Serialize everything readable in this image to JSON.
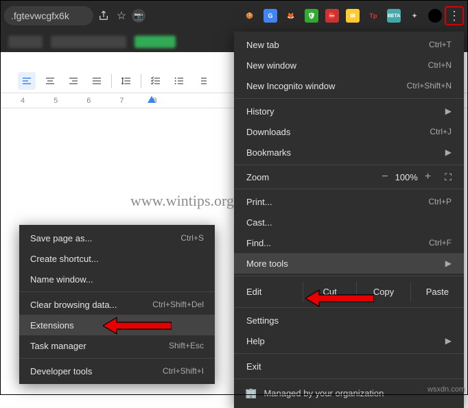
{
  "address_bar": {
    "url_fragment": ".fgtevwcgfx6k"
  },
  "ruler": {
    "marks": [
      "4",
      "5",
      "6",
      "7",
      "8"
    ]
  },
  "main_menu": {
    "new_tab": {
      "label": "New tab",
      "shortcut": "Ctrl+T"
    },
    "new_window": {
      "label": "New window",
      "shortcut": "Ctrl+N"
    },
    "new_incognito": {
      "label": "New Incognito window",
      "shortcut": "Ctrl+Shift+N"
    },
    "history": {
      "label": "History"
    },
    "downloads": {
      "label": "Downloads",
      "shortcut": "Ctrl+J"
    },
    "bookmarks": {
      "label": "Bookmarks"
    },
    "zoom": {
      "label": "Zoom",
      "value": "100%"
    },
    "print": {
      "label": "Print...",
      "shortcut": "Ctrl+P"
    },
    "cast": {
      "label": "Cast..."
    },
    "find": {
      "label": "Find...",
      "shortcut": "Ctrl+F"
    },
    "more_tools": {
      "label": "More tools"
    },
    "edit": {
      "label": "Edit",
      "cut": "Cut",
      "copy": "Copy",
      "paste": "Paste"
    },
    "settings": {
      "label": "Settings"
    },
    "help": {
      "label": "Help"
    },
    "exit": {
      "label": "Exit"
    },
    "managed": {
      "label": "Managed by your organization"
    }
  },
  "sub_menu": {
    "save_page": {
      "label": "Save page as...",
      "shortcut": "Ctrl+S"
    },
    "create_shortcut": {
      "label": "Create shortcut..."
    },
    "name_window": {
      "label": "Name window..."
    },
    "clear_data": {
      "label": "Clear browsing data...",
      "shortcut": "Ctrl+Shift+Del"
    },
    "extensions": {
      "label": "Extensions"
    },
    "task_manager": {
      "label": "Task manager",
      "shortcut": "Shift+Esc"
    },
    "dev_tools": {
      "label": "Developer tools",
      "shortcut": "Ctrl+Shift+I"
    }
  },
  "watermark": "www.wintips.org",
  "source": "wsxdn.com"
}
